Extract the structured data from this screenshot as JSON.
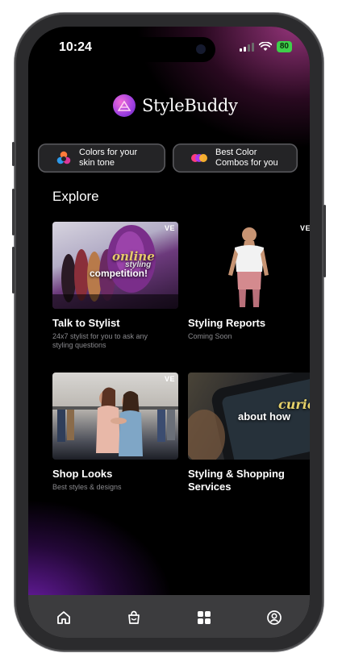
{
  "status_bar": {
    "time": "10:24",
    "battery": "80"
  },
  "app": {
    "name": "StyleBuddy"
  },
  "chips": [
    {
      "label": "Colors for your\nskin tone",
      "icon": "color-wheel-icon"
    },
    {
      "label": "Best Color\nCombos for you",
      "icon": "color-dots-icon"
    }
  ],
  "explore": {
    "title": "Explore",
    "cards": [
      {
        "title": "Talk to Stylist",
        "subtitle": "24x7 stylist for you to ask any styling questions",
        "badge": "VE",
        "overlay_1": "online",
        "overlay_2": "styling",
        "overlay_3": "competition!"
      },
      {
        "title": "Styling Reports",
        "subtitle": "Coming Soon",
        "badge": "VE"
      },
      {
        "title": "Shop Looks",
        "subtitle": "Best styles & designs",
        "badge": "VE"
      },
      {
        "title": "Styling & Shopping Services",
        "subtitle": "",
        "overlay_1": "curio",
        "overlay_2": "about how"
      }
    ]
  },
  "tabbar": [
    {
      "icon": "home-icon"
    },
    {
      "icon": "shopping-bag-icon"
    },
    {
      "icon": "grid-icon"
    },
    {
      "icon": "profile-icon"
    }
  ],
  "colors": {
    "accent_pink": "#d94fd0",
    "accent_purple": "#7a2ad0",
    "background": "#000000",
    "tabbar": "#3c3c3e"
  }
}
